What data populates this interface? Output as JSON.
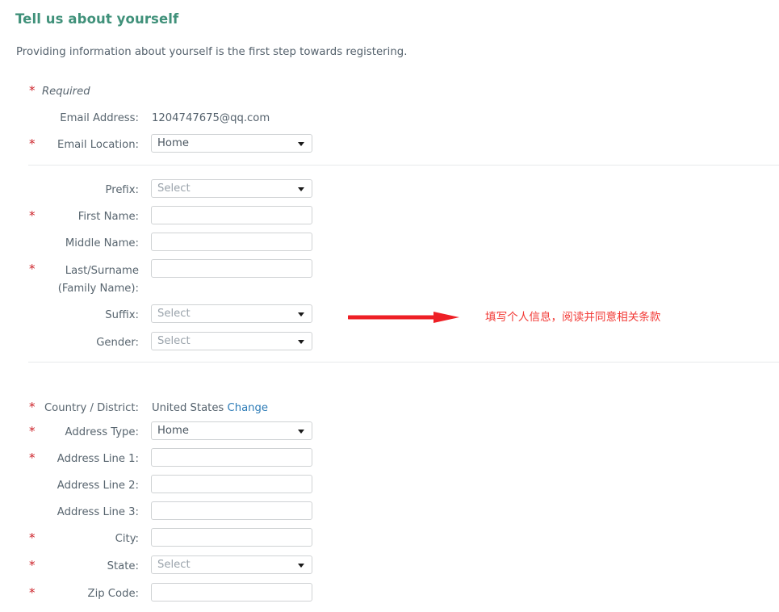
{
  "header": {
    "title": "Tell us about yourself",
    "subtitle": "Providing information about yourself is the first step towards registering.",
    "title_color": "#40917a"
  },
  "legend": {
    "required_label": "Required",
    "asterisk": "*",
    "asterisk_color": "#cc2229"
  },
  "section_email": {
    "rows": [
      {
        "label": "Email Address:",
        "required": false,
        "type": "text-value",
        "value": "1204747675@qq.com"
      },
      {
        "label": "Email Location:",
        "required": true,
        "type": "select",
        "value": "Home"
      }
    ]
  },
  "section_name": {
    "rows": [
      {
        "label": "Prefix:",
        "required": false,
        "type": "select",
        "value": "Select",
        "is_placeholder": true
      },
      {
        "label": "First Name:",
        "required": true,
        "type": "input",
        "value": "",
        "placeholder": ""
      },
      {
        "label": "Middle Name:",
        "required": false,
        "type": "input",
        "value": "",
        "placeholder": ""
      },
      {
        "label": "Last/Surname\n(Family Name):",
        "label_line1": "Last/Surname",
        "label_line2": "(Family Name):",
        "required": true,
        "type": "input",
        "value": "",
        "placeholder": ""
      },
      {
        "label": "Suffix:",
        "required": false,
        "type": "select",
        "value": "Select",
        "is_placeholder": true
      },
      {
        "label": "Gender:",
        "required": false,
        "type": "select",
        "value": "Select",
        "is_placeholder": true
      }
    ]
  },
  "section_address": {
    "rows": [
      {
        "label": "Country / District:",
        "required": true,
        "type": "text-link",
        "value": "United States",
        "link_label": "Change"
      },
      {
        "label": "Address Type:",
        "required": true,
        "type": "select",
        "value": "Home"
      },
      {
        "label": "Address Line 1:",
        "required": true,
        "type": "input",
        "value": "",
        "placeholder": ""
      },
      {
        "label": "Address Line 2:",
        "required": false,
        "type": "input",
        "value": "",
        "placeholder": ""
      },
      {
        "label": "Address Line 3:",
        "required": false,
        "type": "input",
        "value": "",
        "placeholder": ""
      },
      {
        "label": "City:",
        "required": true,
        "type": "input",
        "value": "",
        "placeholder": ""
      },
      {
        "label": "State:",
        "required": true,
        "type": "select",
        "value": "Select",
        "is_placeholder": true
      },
      {
        "label": "Zip Code:",
        "required": true,
        "type": "input",
        "value": "",
        "placeholder": ""
      }
    ]
  },
  "annotation": {
    "text": "填写个人信息，阅读并同意相关条款",
    "color": "#f23a36",
    "arrow_color": "#ee1f25"
  }
}
